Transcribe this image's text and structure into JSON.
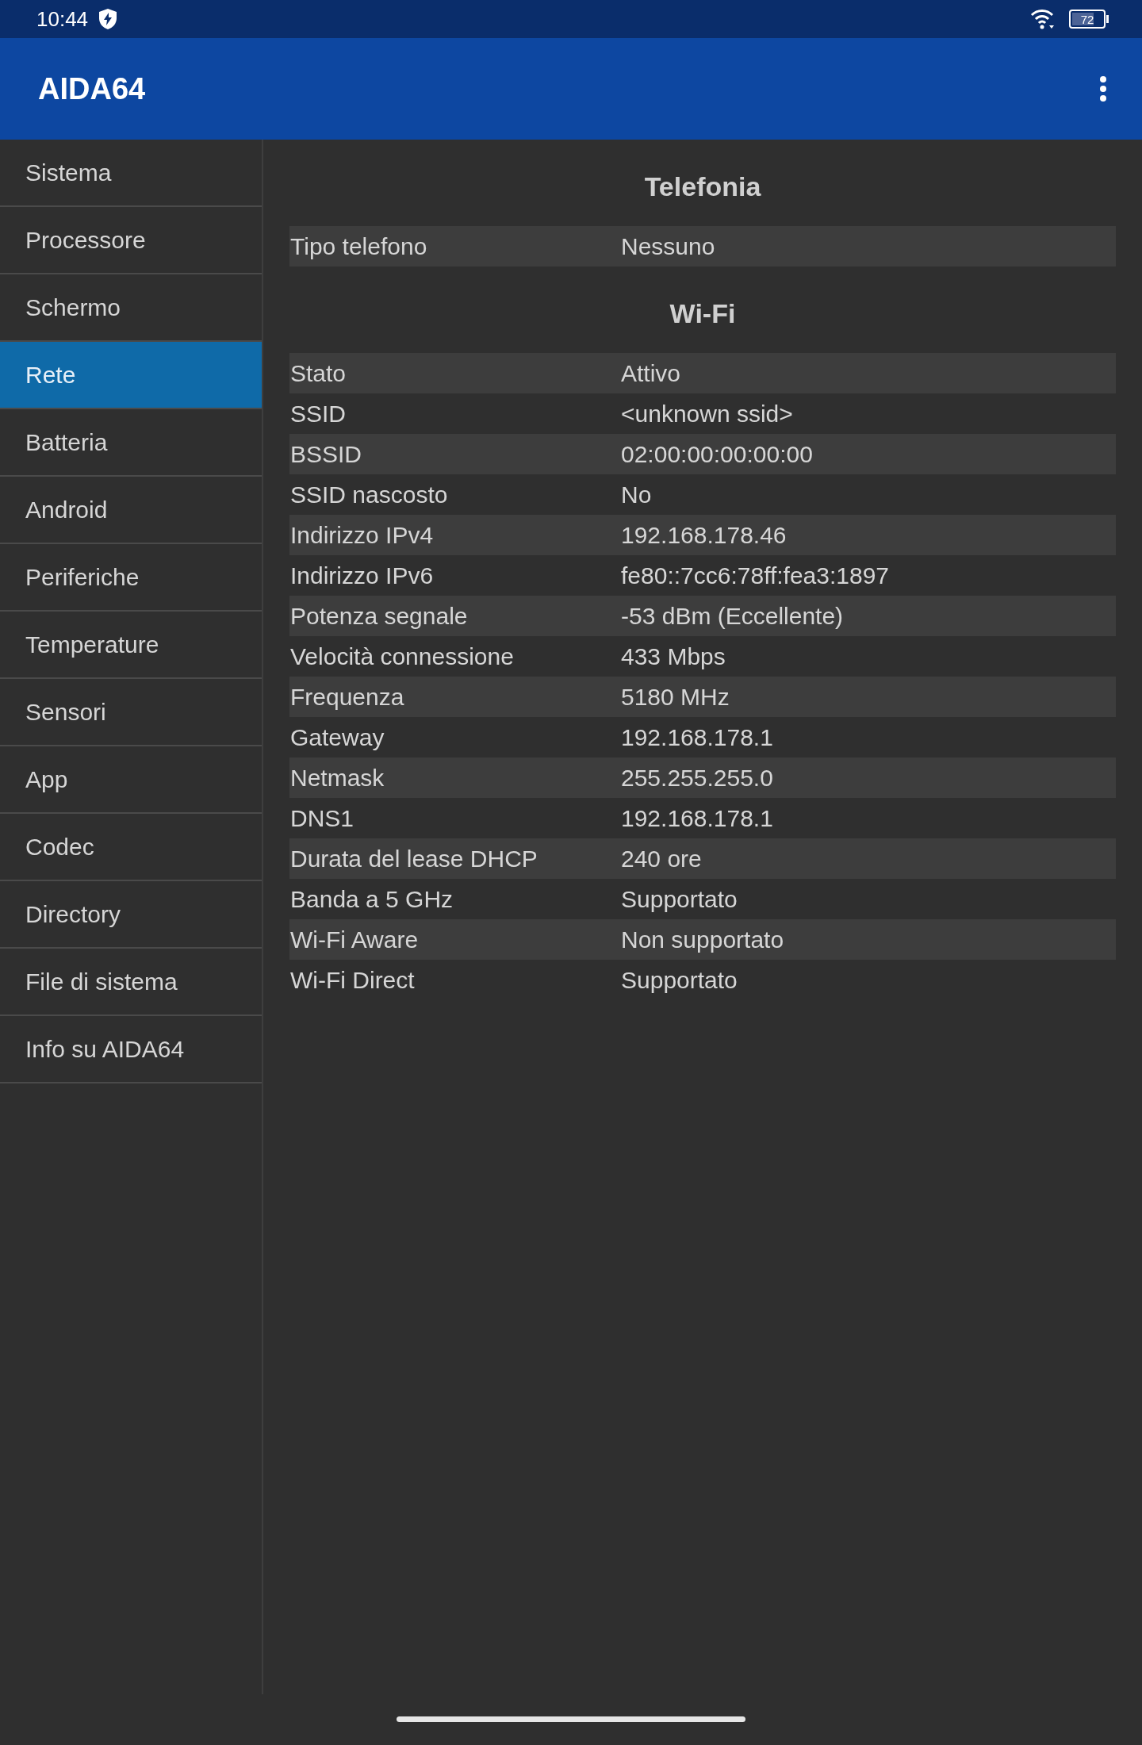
{
  "status_bar": {
    "time": "10:44",
    "battery": {
      "text": "72",
      "level": 0.72
    }
  },
  "app_bar": {
    "title": "AIDA64"
  },
  "sidebar": {
    "items": [
      {
        "label": "Sistema",
        "selected": false
      },
      {
        "label": "Processore",
        "selected": false
      },
      {
        "label": "Schermo",
        "selected": false
      },
      {
        "label": "Rete",
        "selected": true
      },
      {
        "label": "Batteria",
        "selected": false
      },
      {
        "label": "Android",
        "selected": false
      },
      {
        "label": "Periferiche",
        "selected": false
      },
      {
        "label": "Temperature",
        "selected": false
      },
      {
        "label": "Sensori",
        "selected": false
      },
      {
        "label": "App",
        "selected": false
      },
      {
        "label": "Codec",
        "selected": false
      },
      {
        "label": "Directory",
        "selected": false
      },
      {
        "label": "File di sistema",
        "selected": false
      },
      {
        "label": "Info su AIDA64",
        "selected": false
      }
    ]
  },
  "sections": [
    {
      "title": "Telefonia",
      "rows": [
        {
          "label": "Tipo telefono",
          "value": "Nessuno"
        }
      ]
    },
    {
      "title": "Wi-Fi",
      "rows": [
        {
          "label": "Stato",
          "value": "Attivo"
        },
        {
          "label": "SSID",
          "value": "<unknown ssid>"
        },
        {
          "label": "BSSID",
          "value": "02:00:00:00:00:00"
        },
        {
          "label": "SSID nascosto",
          "value": "No"
        },
        {
          "label": "Indirizzo IPv4",
          "value": "192.168.178.46"
        },
        {
          "label": "Indirizzo IPv6",
          "value": "fe80::7cc6:78ff:fea3:1897"
        },
        {
          "label": "Potenza segnale",
          "value": "-53 dBm (Eccellente)"
        },
        {
          "label": "Velocità connessione",
          "value": "433 Mbps"
        },
        {
          "label": "Frequenza",
          "value": "5180 MHz"
        },
        {
          "label": "Gateway",
          "value": "192.168.178.1"
        },
        {
          "label": "Netmask",
          "value": "255.255.255.0"
        },
        {
          "label": "DNS1",
          "value": "192.168.178.1"
        },
        {
          "label": "Durata del lease DHCP",
          "value": "240 ore"
        },
        {
          "label": "Banda a 5 GHz",
          "value": "Supportato"
        },
        {
          "label": "Wi-Fi Aware",
          "value": "Non supportato"
        },
        {
          "label": "Wi-Fi Direct",
          "value": "Supportato"
        }
      ]
    }
  ]
}
